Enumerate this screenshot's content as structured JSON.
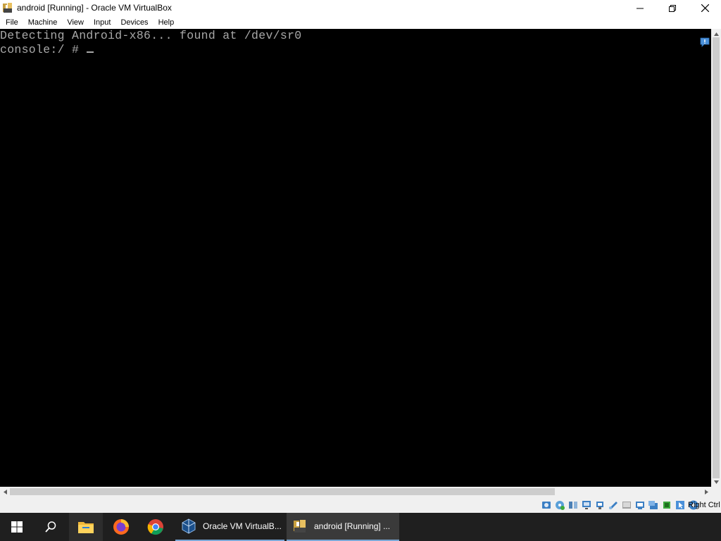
{
  "window": {
    "title": "android [Running] - Oracle VM VirtualBox",
    "app_icon": "virtualbox-vm-icon",
    "controls": [
      "minimize-icon",
      "maximize-icon",
      "close-icon"
    ]
  },
  "menu": {
    "items": [
      {
        "label": "File"
      },
      {
        "label": "Machine"
      },
      {
        "label": "View"
      },
      {
        "label": "Input"
      },
      {
        "label": "Devices"
      },
      {
        "label": "Help"
      }
    ]
  },
  "console": {
    "lines": [
      "Detecting Android-x86... found at /dev/sr0",
      "console:/ # "
    ],
    "text_color": "#a8a8a8",
    "background": "#000000"
  },
  "status_bar": {
    "icons": [
      "hard-disk-icon",
      "optical-drive-icon",
      "audio-icon",
      "network-icon",
      "usb-icon",
      "shared-folders-icon",
      "display-icon",
      "capture-icon",
      "recording-icon",
      "cpu-icon",
      "mouse-integration-icon",
      "keyboard-icon"
    ],
    "host_key": "Right Ctrl"
  },
  "taskbar": {
    "pinned": [
      "windows-start-icon",
      "search-icon",
      "file-explorer-icon",
      "firefox-icon",
      "chrome-icon"
    ],
    "tasks": [
      {
        "label": "Oracle VM VirtualB...",
        "icon": "virtualbox-icon"
      },
      {
        "label": "android [Running] ...",
        "icon": "virtualbox-vm-icon"
      }
    ]
  }
}
